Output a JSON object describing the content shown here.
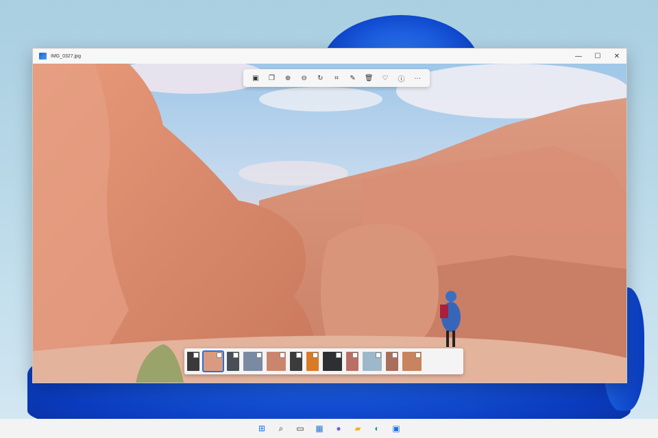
{
  "window": {
    "title": "IMG_0327.jpg",
    "controls": [
      {
        "name": "minimize-button",
        "glyph": "—"
      },
      {
        "name": "maximize-button",
        "glyph": "☐"
      },
      {
        "name": "close-button",
        "glyph": "✕"
      }
    ]
  },
  "toolbar": {
    "buttons": [
      {
        "name": "view-actual-size-button",
        "icon": "frame-icon",
        "glyph": "▣"
      },
      {
        "name": "copy-button",
        "icon": "copy-icon",
        "glyph": "❐"
      },
      {
        "name": "zoom-in-button",
        "icon": "zoom-in-icon",
        "glyph": "⊕"
      },
      {
        "name": "zoom-out-button",
        "icon": "zoom-out-icon",
        "glyph": "⊖"
      },
      {
        "name": "rotate-button",
        "icon": "rotate-icon",
        "glyph": "↻"
      },
      {
        "name": "crop-button",
        "icon": "crop-icon",
        "glyph": "⌗"
      },
      {
        "name": "edit-button",
        "icon": "pen-icon",
        "glyph": "✎"
      },
      {
        "name": "delete-button",
        "icon": "trash-icon",
        "glyph": "🗑"
      },
      {
        "name": "favorite-button",
        "icon": "heart-icon",
        "glyph": "♡"
      },
      {
        "name": "info-button",
        "icon": "info-icon",
        "glyph": "ⓘ"
      },
      {
        "name": "more-button",
        "icon": "more-icon",
        "glyph": "···"
      }
    ]
  },
  "filmstrip": {
    "thumbs": [
      {
        "w": 18,
        "color": "#3a3a3a",
        "selected": false
      },
      {
        "w": 28,
        "color": "#d99a7f",
        "selected": true
      },
      {
        "w": 18,
        "color": "#4a4f57",
        "selected": false
      },
      {
        "w": 28,
        "color": "#7a8aa0",
        "selected": false
      },
      {
        "w": 28,
        "color": "#c9866d",
        "selected": false
      },
      {
        "w": 18,
        "color": "#3b3b3b",
        "selected": false
      },
      {
        "w": 18,
        "color": "#d97a25",
        "selected": false
      },
      {
        "w": 28,
        "color": "#2d2f33",
        "selected": false
      },
      {
        "w": 18,
        "color": "#b86f66",
        "selected": false
      },
      {
        "w": 28,
        "color": "#9db8c8",
        "selected": false
      },
      {
        "w": 18,
        "color": "#a86f5c",
        "selected": false
      },
      {
        "w": 28,
        "color": "#c8845e",
        "selected": false
      }
    ]
  },
  "taskbar": {
    "icons": [
      {
        "name": "start-icon",
        "glyph": "⊞",
        "color": "#1e6fe0"
      },
      {
        "name": "search-icon",
        "glyph": "⌕",
        "color": "#222"
      },
      {
        "name": "task-view-icon",
        "glyph": "▭",
        "color": "#333"
      },
      {
        "name": "widgets-icon",
        "glyph": "▦",
        "color": "#2a7ad6"
      },
      {
        "name": "chat-icon",
        "glyph": "●",
        "color": "#7b5ce0"
      },
      {
        "name": "file-explorer-icon",
        "glyph": "▰",
        "color": "#f0b429"
      },
      {
        "name": "edge-icon",
        "glyph": "◐",
        "color": "#1a9c8a"
      },
      {
        "name": "photos-icon",
        "glyph": "▣",
        "color": "#1e6fe0"
      }
    ]
  }
}
